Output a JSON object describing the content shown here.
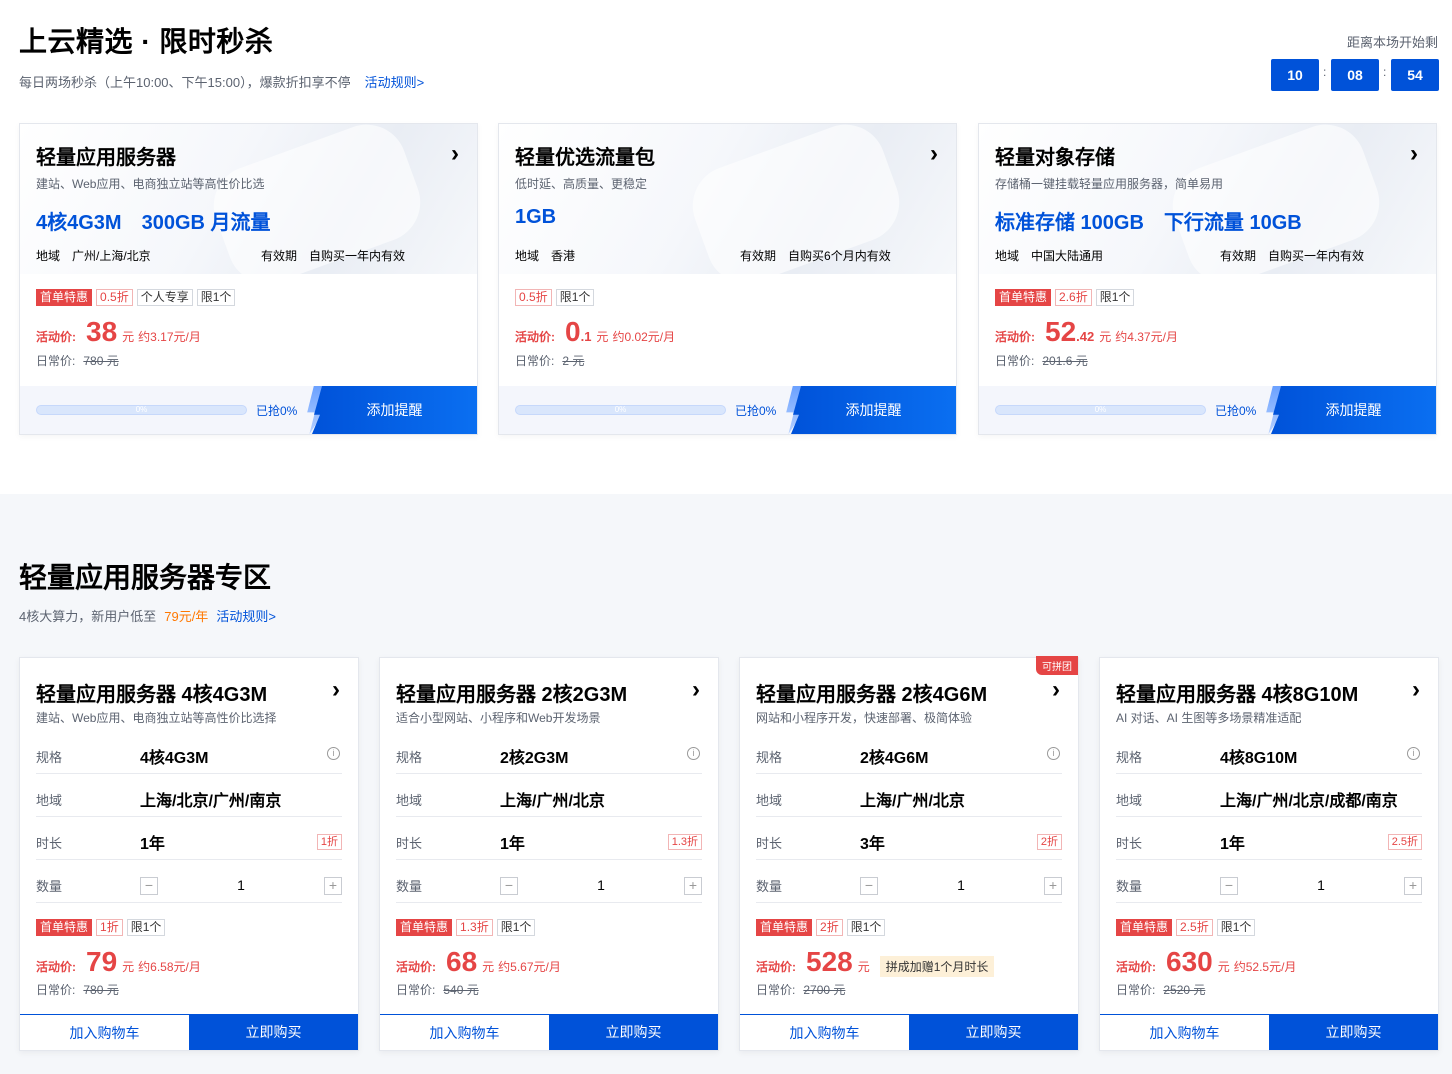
{
  "flash": {
    "title": "上云精选 · 限时秒杀",
    "subtitle": "每日两场秒杀（上午10:00、下午15:00），爆款折扣享不停",
    "rules_link": "活动规则>",
    "countdown_label": "距离本场开始剩",
    "countdown": [
      "10",
      "08",
      "54"
    ],
    "cards": [
      {
        "title": "轻量应用服务器",
        "desc": "建站、Web应用、电商独立站等高性价比选",
        "specs": [
          "4核4G3M",
          "300GB 月流量"
        ],
        "region_label": "地域",
        "region": "广州/上海/北京",
        "validity_label": "有效期",
        "validity": "自购买一年内有效",
        "tags": [
          "首单特惠",
          "0.5折",
          "个人专享",
          "限1个"
        ],
        "price_label": "活动价:",
        "price_int": "38",
        "price_dec": "",
        "price_unit": "元",
        "price_per": "约3.17元/月",
        "orig_label": "日常价:",
        "orig": "780 元",
        "progress": 0,
        "progress_text": "0%",
        "sold_text": "已抢0%",
        "remind": "添加提醒"
      },
      {
        "title": "轻量优选流量包",
        "desc": "低时延、高质量、更稳定",
        "specs": [
          "1GB"
        ],
        "region_label": "地域",
        "region": "香港",
        "validity_label": "有效期",
        "validity": "自购买6个月内有效",
        "tags": [
          "0.5折",
          "限1个"
        ],
        "price_label": "活动价:",
        "price_int": "0",
        "price_dec": ".1",
        "price_unit": "元",
        "price_per": "约0.02元/月",
        "orig_label": "日常价:",
        "orig": "2 元",
        "progress": 0,
        "progress_text": "0%",
        "sold_text": "已抢0%",
        "remind": "添加提醒"
      },
      {
        "title": "轻量对象存储",
        "desc": "存储桶一键挂载轻量应用服务器，简单易用",
        "specs": [
          "标准存储 100GB",
          "下行流量 10GB"
        ],
        "region_label": "地域",
        "region": "中国大陆通用",
        "validity_label": "有效期",
        "validity": "自购买一年内有效",
        "tags": [
          "首单特惠",
          "2.6折",
          "限1个"
        ],
        "price_label": "活动价:",
        "price_int": "52",
        "price_dec": ".42",
        "price_unit": "元",
        "price_per": "约4.37元/月",
        "orig_label": "日常价:",
        "orig": "201.6 元",
        "progress": 0,
        "progress_text": "0%",
        "sold_text": "已抢0%",
        "remind": "添加提醒"
      }
    ]
  },
  "zone": {
    "title": "轻量应用服务器专区",
    "subtitle": "4核大算力，新用户低至",
    "highlight": "79元/年",
    "rules_link": "活动规则>",
    "cards": [
      {
        "title": "轻量应用服务器 4核4G3M",
        "desc": "建站、Web应用、电商独立站等高性价比选择",
        "badge": "",
        "spec_label": "规格",
        "spec": "4核4G3M",
        "region_label": "地域",
        "region": "上海/北京/广州/南京",
        "duration_label": "时长",
        "duration": "1年",
        "duration_disc": "1折",
        "qty_label": "数量",
        "qty": "1",
        "tags": [
          "首单特惠",
          "1折",
          "限1个"
        ],
        "price_label": "活动价:",
        "price_int": "79",
        "price_unit": "元",
        "price_per": "约6.58元/月",
        "gift": "",
        "orig_label": "日常价:",
        "orig": "780 元",
        "cart": "加入购物车",
        "buy": "立即购买"
      },
      {
        "title": "轻量应用服务器 2核2G3M",
        "desc": "适合小型网站、小程序和Web开发场景",
        "badge": "",
        "spec_label": "规格",
        "spec": "2核2G3M",
        "region_label": "地域",
        "region": "上海/广州/北京",
        "duration_label": "时长",
        "duration": "1年",
        "duration_disc": "1.3折",
        "qty_label": "数量",
        "qty": "1",
        "tags": [
          "首单特惠",
          "1.3折",
          "限1个"
        ],
        "price_label": "活动价:",
        "price_int": "68",
        "price_unit": "元",
        "price_per": "约5.67元/月",
        "gift": "",
        "orig_label": "日常价:",
        "orig": "540 元",
        "cart": "加入购物车",
        "buy": "立即购买"
      },
      {
        "title": "轻量应用服务器 2核4G6M",
        "desc": "网站和小程序开发，快速部署、极简体验",
        "badge": "可拼团",
        "spec_label": "规格",
        "spec": "2核4G6M",
        "region_label": "地域",
        "region": "上海/广州/北京",
        "duration_label": "时长",
        "duration": "3年",
        "duration_disc": "2折",
        "qty_label": "数量",
        "qty": "1",
        "tags": [
          "首单特惠",
          "2折",
          "限1个"
        ],
        "price_label": "活动价:",
        "price_int": "528",
        "price_unit": "元",
        "price_per": "",
        "gift": "拼成加赠1个月时长",
        "orig_label": "日常价:",
        "orig": "2700 元",
        "cart": "加入购物车",
        "buy": "立即购买"
      },
      {
        "title": "轻量应用服务器 4核8G10M",
        "desc": "AI 对话、AI 生图等多场景精准适配",
        "badge": "",
        "spec_label": "规格",
        "spec": "4核8G10M",
        "region_label": "地域",
        "region": "上海/广州/北京/成都/南京",
        "duration_label": "时长",
        "duration": "1年",
        "duration_disc": "2.5折",
        "qty_label": "数量",
        "qty": "1",
        "tags": [
          "首单特惠",
          "2.5折",
          "限1个"
        ],
        "price_label": "活动价:",
        "price_int": "630",
        "price_unit": "元",
        "price_per": "约52.5元/月",
        "gift": "",
        "orig_label": "日常价:",
        "orig": "2520 元",
        "cart": "加入购物车",
        "buy": "立即购买"
      }
    ]
  },
  "colors": {
    "brand": "#0052d9",
    "danger": "#e54545",
    "highlight": "#ff7800"
  },
  "icons": [
    "chevron-right-icon",
    "info-icon",
    "minus-icon",
    "plus-icon",
    "lightning-icon",
    "group-icon"
  ]
}
